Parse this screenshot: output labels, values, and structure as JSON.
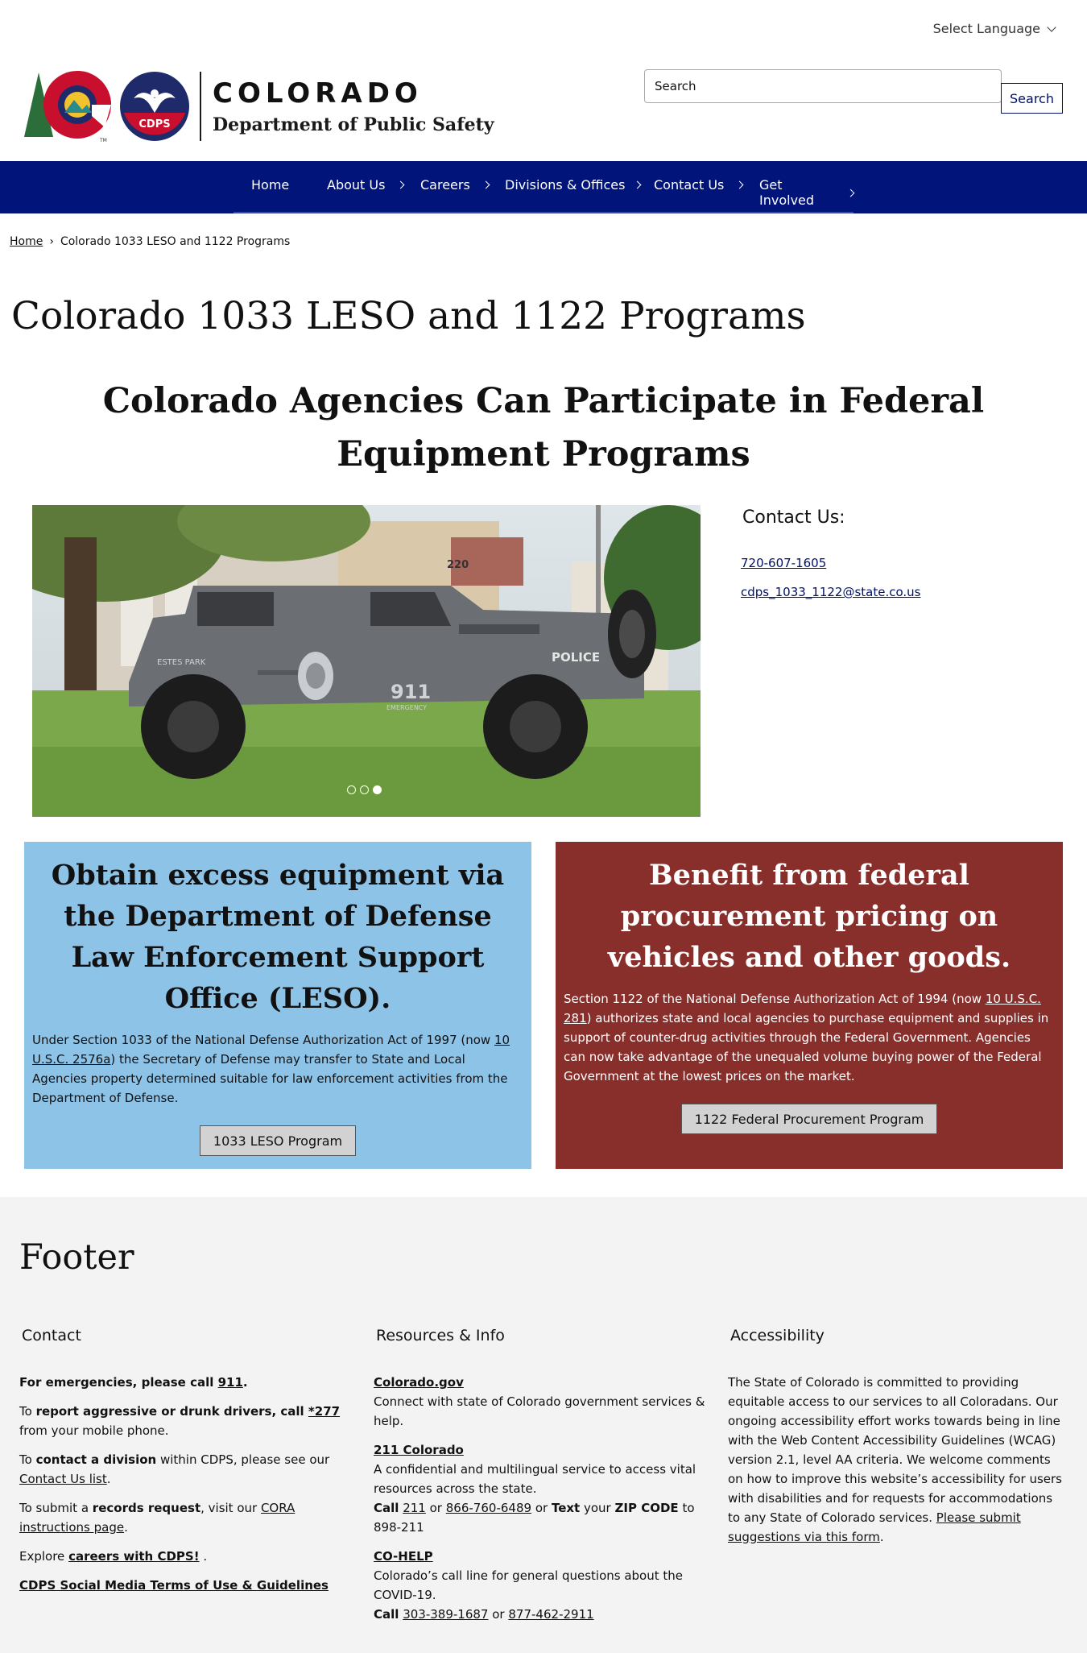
{
  "header": {
    "language": "Select Language",
    "brand_title": "COLORADO",
    "brand_subtitle": "Department of Public Safety",
    "cdps_badge": "CDPS",
    "search_placeholder": "Search",
    "search_button": "Search"
  },
  "nav": {
    "items": [
      {
        "label": "Home",
        "chevron": false
      },
      {
        "label": "About Us",
        "chevron": true
      },
      {
        "label": "Careers",
        "chevron": true
      },
      {
        "label": "Divisions & Offices",
        "chevron": true
      },
      {
        "label": "Contact Us",
        "chevron": true
      },
      {
        "label": "Get Involved",
        "chevron": true
      }
    ]
  },
  "breadcrumb": {
    "home": "Home",
    "separator": "›",
    "current": "Colorado 1033 LESO and 1122 Programs"
  },
  "page_title": "Colorado 1033 LESO and 1122 Programs",
  "subtitle": "Colorado Agencies Can Participate in Federal Equipment Programs",
  "carousel": {
    "slide_count": 3,
    "active_slide": 3,
    "vehicle_text": {
      "police": "POLICE",
      "number": "911",
      "emergency": "EMERGENCY",
      "estes": "ESTES PARK",
      "building": "220"
    }
  },
  "contact": {
    "heading": "Contact Us:",
    "phone": "720-607-1605",
    "email": "cdps_1033_1122@state.co.us"
  },
  "cards": {
    "leso": {
      "heading": "Obtain excess equipment via the Department of Defense Law Enforcement Support Office (LESO).",
      "text_before": "Under Section 1033 of the National Defense Authorization Act of 1997 (now ",
      "link": "10 U.S.C. 2576a",
      "text_after": ") the Secretary of Defense may transfer to State and Local Agencies property determined suitable for law enforcement activities from the Department of Defense.",
      "button": "1033 LESO Program"
    },
    "procurement": {
      "heading": "Benefit from federal procurement pricing on vehicles and other goods.",
      "text_before": "Section 1122 of the National Defense Authorization Act of 1994 (now ",
      "link": "10 U.S.C. 281",
      "text_after": ") authorizes state and local agencies to purchase equipment and supplies in support of counter-drug activities through the Federal Government. Agencies can now take advantage of the unequaled volume buying power of the Federal Government at the lowest prices on the market.",
      "button": "1122 Federal Procurement Program"
    }
  },
  "footer": {
    "title": "Footer",
    "contact": {
      "heading": "Contact",
      "emergency_pre": "For emergencies, please call ",
      "emergency_link": "911",
      "emergency_post": ".",
      "drunk_pre": "To ",
      "drunk_bold": "report aggressive or drunk drivers, call ",
      "drunk_link": "*277",
      "drunk_post": " from your mobile phone.",
      "division_pre": "To ",
      "division_bold": "contact a division",
      "division_mid": " within CDPS, please see our ",
      "division_link": "Contact Us list",
      "division_post": ".",
      "records_pre": "To submit a ",
      "records_bold": "records request",
      "records_mid": ", visit our ",
      "records_link": "CORA instructions page",
      "records_post": ".",
      "careers_pre": "Explore ",
      "careers_link": "careers with CDPS!",
      "careers_post": " .",
      "social_link": "CDPS Social Media Terms of Use & Guidelines"
    },
    "resources": {
      "heading": "Resources & Info",
      "colorado_link": "Colorado.gov",
      "colorado_text": "Connect with state of Colorado government services & help.",
      "c211_link": "211 Colorado",
      "c211_text": "A confidential and multilingual service to access vital resources across the state.",
      "c211_call": "Call",
      "c211_num1": "211",
      "c211_or": "or",
      "c211_num2": "866-760-6489",
      "c211_or2": "or",
      "c211_textword": "Text",
      "c211_your": "your",
      "c211_zip": "ZIP CODE",
      "c211_to": "to 898-211",
      "cohelp_link": "CO-HELP",
      "cohelp_text": "Colorado’s call line for general questions about the COVID-19.",
      "cohelp_call": "Call",
      "cohelp_num1": "303-389-1687",
      "cohelp_or": "or",
      "cohelp_num2": "877-462-2911"
    },
    "accessibility": {
      "heading": "Accessibility",
      "text": "The State of Colorado is committed to providing equitable access to our services to all Coloradans. Our ongoing accessibility effort works towards being in line with the Web Content Accessibility Guidelines (WCAG) version 2.1, level AA criteria. We welcome comments on how to improve this website’s accessibility for users with disabilities and for requests for accommodations to any State of Colorado services. ",
      "link": "Please submit suggestions via this form",
      "post": "."
    }
  },
  "colors": {
    "nav": "#001479",
    "card_blue": "#8ec3e8",
    "card_red": "#882f2b",
    "footer_bg": "#f3f3f3",
    "link": "#00106b"
  }
}
